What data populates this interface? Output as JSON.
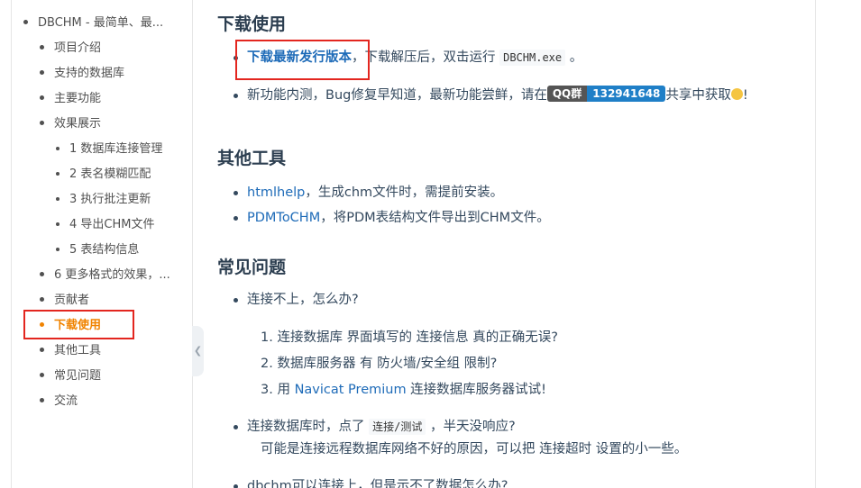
{
  "sidebar": {
    "items": [
      {
        "label": "DBCHM - 最简单、最...",
        "level": 0
      },
      {
        "label": "项目介绍",
        "level": 1
      },
      {
        "label": "支持的数据库",
        "level": 1
      },
      {
        "label": "主要功能",
        "level": 1
      },
      {
        "label": "效果展示",
        "level": 1
      },
      {
        "label": "1 数据库连接管理",
        "level": 2
      },
      {
        "label": "2 表名模糊匹配",
        "level": 2
      },
      {
        "label": "3 执行批注更新",
        "level": 2
      },
      {
        "label": "4 导出CHM文件",
        "level": 2
      },
      {
        "label": "5 表结构信息",
        "level": 2
      },
      {
        "label": "6 更多格式的效果，...",
        "level": 1
      },
      {
        "label": "贡献者",
        "level": 1
      },
      {
        "label": "下载使用",
        "level": 1,
        "active": true
      },
      {
        "label": "其他工具",
        "level": 1
      },
      {
        "label": "常见问题",
        "level": 1
      },
      {
        "label": "交流",
        "level": 1
      }
    ],
    "collapse_icon": "chevron-left-icon"
  },
  "download": {
    "heading": "下载使用",
    "item1": {
      "link": "下载最新发行版本",
      "text": "，下载解压后，双击运行",
      "code": "DBCHM.exe",
      "tail": "。"
    },
    "item2": {
      "text": "新功能内测，Bug修复早知道，最新功能尝鲜，请在",
      "badge_left": "QQ群",
      "badge_right": "132941648",
      "tail": "共享中获取",
      "end": "!"
    }
  },
  "tools": {
    "heading": "其他工具",
    "items": [
      {
        "link": "htmlhelp",
        "text": "，生成chm文件时，需提前安装。"
      },
      {
        "link": "PDMToCHM",
        "text": "，将PDM表结构文件导出到CHM文件。"
      }
    ]
  },
  "faq": {
    "heading": "常见问题",
    "q1": "连接不上，怎么办?",
    "q1_steps": [
      {
        "num": "1.",
        "text": "连接数据库 界面填写的 连接信息 真的正确无误?"
      },
      {
        "num": "2.",
        "text": "数据库服务器 有 防火墙/安全组 限制?"
      },
      {
        "num": "3.",
        "pre": "用 ",
        "link": "Navicat Premium",
        "text": " 连接数据库服务器试试!"
      }
    ],
    "q2_pre": "连接数据库时，点了",
    "q2_code": "连接/测试",
    "q2_post": "，半天没响应?",
    "q2_answer": "可能是连接远程数据库网络不好的原因，可以把 连接超时 设置的小一些。",
    "q3": "dbchm可以连接上，但是示不了数据怎么办?"
  }
}
